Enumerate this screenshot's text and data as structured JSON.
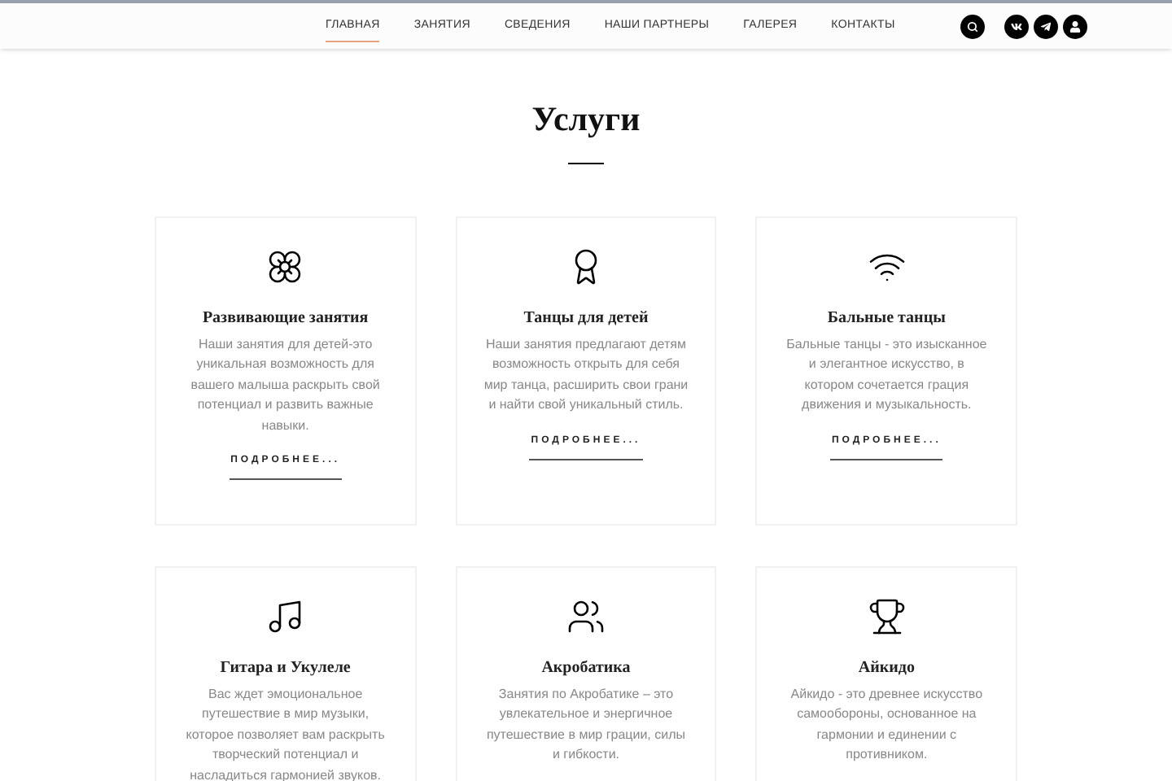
{
  "nav": {
    "items": [
      {
        "label": "ГЛАВНАЯ",
        "selected": true
      },
      {
        "label": "ЗАНЯТИЯ",
        "selected": false
      },
      {
        "label": "СВЕДЕНИЯ",
        "selected": false
      },
      {
        "label": "НАШИ ПАРТНЕРЫ",
        "selected": false
      },
      {
        "label": "ГАЛЕРЕЯ",
        "selected": false
      },
      {
        "label": "КОНТАКТЫ",
        "selected": false
      }
    ],
    "icons": [
      {
        "kind": "search"
      },
      {
        "kind": "vk"
      },
      {
        "kind": "telegram"
      },
      {
        "kind": "user"
      }
    ]
  },
  "section": {
    "title": "Услуги",
    "cards": [
      {
        "title": "Развивающие занятия",
        "text": "Наши занятия для детей-это уникальная возможность для вашего малыша раскрыть свой потенциал и развить важные навыки.",
        "link": "ПОДРОБНЕЕ..."
      },
      {
        "title": "Танцы для детей",
        "text": "Наши занятия предлагают детям возможность открыть для себя мир танца, расширить свои грани и найти свой уникальный стиль.",
        "link": "ПОДРОБНЕЕ..."
      },
      {
        "title": "Бальные танцы",
        "text": "Бальные танцы - это изысканное и элегантное искусство, в котором сочетается грация движения и музыкальность.",
        "link": "ПОДРОБНЕЕ..."
      },
      {
        "title": "Гитара и Укулеле",
        "text": "Вас ждет эмоциональное путешествие в мир музыки, которое позволяет вам раскрыть творческий потенциал и насладиться гармонией звуков."
      },
      {
        "title": "Акробатика",
        "text": "Занятия по Акробатике – это увлекательное и энергичное путешествие в мир грации, силы и гибкости."
      },
      {
        "title": "Айкидо",
        "text": "Айкидо - это древнее искусство самообороны, основанное на гармонии и единении с противником."
      }
    ]
  }
}
